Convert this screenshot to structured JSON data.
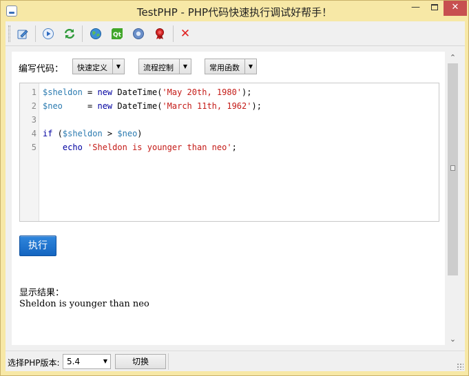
{
  "window": {
    "title": "TestPHP - PHP代码快速执行调试好帮手！",
    "min_glyph": "—",
    "close_glyph": "✕"
  },
  "toolbar": {
    "icons": [
      "edit-icon",
      "play-icon",
      "refresh-icon",
      "globe-icon",
      "qt-icon",
      "help-icon",
      "award-icon",
      "close-red-icon"
    ],
    "qt_text": "Qt",
    "close_glyph": "✕"
  },
  "editor_header": {
    "label": "编写代码：",
    "dropdowns": [
      {
        "label": "快速定义"
      },
      {
        "label": "流程控制"
      },
      {
        "label": "常用函数"
      }
    ]
  },
  "code": {
    "line_numbers": [
      "1",
      "2",
      "3",
      "4",
      "5"
    ],
    "lines": [
      [
        {
          "t": "$sheldon",
          "c": "var"
        },
        {
          "t": " = ",
          "c": "fn"
        },
        {
          "t": "new",
          "c": "kw"
        },
        {
          "t": " DateTime(",
          "c": "fn"
        },
        {
          "t": "'May 20th, 1980'",
          "c": "str"
        },
        {
          "t": ");",
          "c": "fn"
        }
      ],
      [
        {
          "t": "$neo",
          "c": "var"
        },
        {
          "t": "     = ",
          "c": "fn"
        },
        {
          "t": "new",
          "c": "kw"
        },
        {
          "t": " DateTime(",
          "c": "fn"
        },
        {
          "t": "'March 11th, 1962'",
          "c": "str"
        },
        {
          "t": ");",
          "c": "fn"
        }
      ],
      [],
      [
        {
          "t": "if",
          "c": "kw"
        },
        {
          "t": " (",
          "c": "fn"
        },
        {
          "t": "$sheldon",
          "c": "var"
        },
        {
          "t": " > ",
          "c": "fn"
        },
        {
          "t": "$neo",
          "c": "var"
        },
        {
          "t": ")",
          "c": "fn"
        }
      ],
      [
        {
          "t": "    ",
          "c": "fn"
        },
        {
          "t": "echo",
          "c": "kw"
        },
        {
          "t": " ",
          "c": "fn"
        },
        {
          "t": "'Sheldon is younger than neo'",
          "c": "str"
        },
        {
          "t": ";",
          "c": "fn"
        }
      ]
    ]
  },
  "run_button": {
    "label": "执行"
  },
  "result": {
    "label": "显示结果：",
    "text": "Sheldon is younger than neo"
  },
  "statusbar": {
    "version_label": "选择PHP版本:",
    "version_value": "5.4",
    "switch_label": "切换"
  },
  "scrollbar": {
    "up_glyph": "⌃",
    "down_glyph": "⌄"
  },
  "colors": {
    "title_bg": "#f7e8a6",
    "run_button": "#1b73d0",
    "string": "#c41a16",
    "keyword": "#0000a0",
    "variable": "#2a7ab0"
  }
}
